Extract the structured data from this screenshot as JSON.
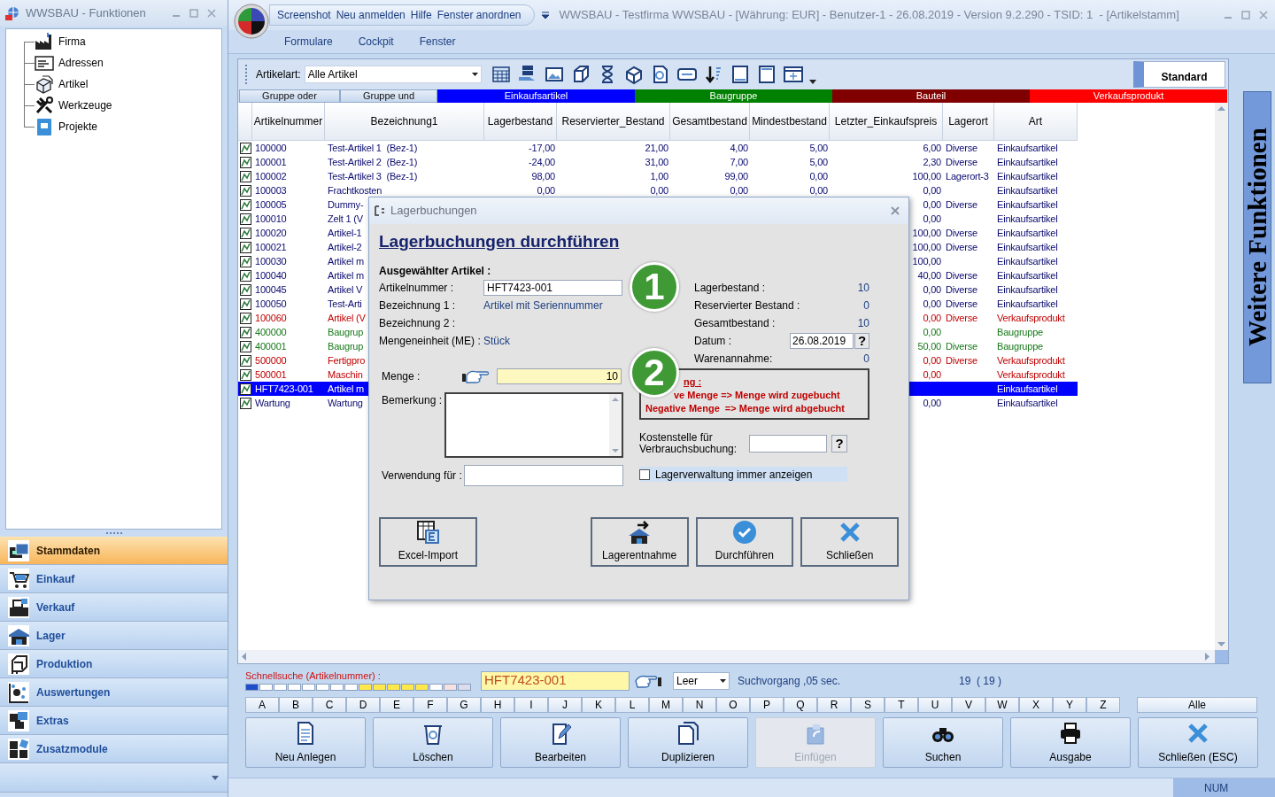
{
  "left_window": {
    "title": "WWSBAU - Funktionen",
    "tree": [
      {
        "label": "Firma"
      },
      {
        "label": "Adressen"
      },
      {
        "label": "Artikel"
      },
      {
        "label": "Werkzeuge"
      },
      {
        "label": "Projekte"
      }
    ],
    "nav": [
      {
        "label": "Stammdaten",
        "selected": true
      },
      {
        "label": "Einkauf",
        "selected": false
      },
      {
        "label": "Verkauf",
        "selected": false
      },
      {
        "label": "Lager",
        "selected": false
      },
      {
        "label": "Produktion",
        "selected": false
      },
      {
        "label": "Auswertungen",
        "selected": false
      },
      {
        "label": "Extras",
        "selected": false
      },
      {
        "label": "Zusatzmodule",
        "selected": false
      }
    ]
  },
  "main_window": {
    "quick_access": [
      "Screenshot",
      "Neu anmelden",
      "Hilfe",
      "Fenster anordnen"
    ],
    "title": "WWSBAU - Testfirma WWSBAU - [Währung: EUR] - Benutzer-1 - 26.08.2019 - Version 9.2.290 - TSID: 1  - [Artikelstamm]",
    "ribbon_tabs": [
      "Formulare",
      "Cockpit",
      "Fenster"
    ]
  },
  "toolbar": {
    "artikelart_label": "Artikelart:",
    "artikelart_value": "Alle Artikel",
    "standard_button": "Standard"
  },
  "legend": [
    {
      "label": "Gruppe oder",
      "kind": "button"
    },
    {
      "label": "Gruppe und",
      "kind": "button"
    },
    {
      "label": "Einkaufsartikel",
      "kind": "swatch",
      "color": "#0000ff"
    },
    {
      "label": "Baugruppe",
      "kind": "swatch",
      "color": "#008000"
    },
    {
      "label": "Bauteil",
      "kind": "swatch",
      "color": "#800000"
    },
    {
      "label": "Verkaufsprodukt",
      "kind": "swatch",
      "color": "#ff0000"
    }
  ],
  "table": {
    "columns": [
      "Artikelnummer",
      "Bezeichnung1",
      "Lagerbestand",
      "Reservierter_Bestand",
      "Gesamtbestand",
      "Mindestbestand",
      "Letzter_Einkaufspreis",
      "Lagerort",
      "Art"
    ],
    "rows": [
      {
        "kind": "einkauf",
        "selected": false,
        "nr": "100000",
        "bez": "Test-Artikel 1  (Bez-1)",
        "lager": "-17,00",
        "reserv": "21,00",
        "gesamt": "4,00",
        "mindest": "5,00",
        "preis": "6,00",
        "ort": "Diverse",
        "art": "Einkaufsartikel"
      },
      {
        "kind": "einkauf",
        "selected": false,
        "nr": "100001",
        "bez": "Test-Artikel 2  (Bez-1)",
        "lager": "-24,00",
        "reserv": "31,00",
        "gesamt": "7,00",
        "mindest": "5,00",
        "preis": "2,30",
        "ort": "Diverse",
        "art": "Einkaufsartikel"
      },
      {
        "kind": "einkauf",
        "selected": false,
        "nr": "100002",
        "bez": "Test-Artikel 3  (Bez-1)",
        "lager": "98,00",
        "reserv": "1,00",
        "gesamt": "99,00",
        "mindest": "0,00",
        "preis": "100,00",
        "ort": "Lagerort-3",
        "art": "Einkaufsartikel"
      },
      {
        "kind": "einkauf",
        "selected": false,
        "nr": "100003",
        "bez": "Frachtkosten",
        "lager": "0,00",
        "reserv": "0,00",
        "gesamt": "0,00",
        "mindest": "0,00",
        "preis": "0,00",
        "art": "Einkaufsartikel"
      },
      {
        "kind": "einkauf",
        "selected": false,
        "nr": "100005",
        "bez": "Dummy-",
        "preis": "0,00",
        "ort": "Diverse",
        "art": "Einkaufsartikel"
      },
      {
        "kind": "einkauf",
        "selected": false,
        "nr": "100010",
        "bez": "Zelt 1 (V",
        "preis": "0,00",
        "art": "Einkaufsartikel"
      },
      {
        "kind": "einkauf",
        "selected": false,
        "nr": "100020",
        "bez": "Artikel-1",
        "preis": "100,00",
        "ort": "Diverse",
        "art": "Einkaufsartikel"
      },
      {
        "kind": "einkauf",
        "selected": false,
        "nr": "100021",
        "bez": "Artikel-2",
        "preis": "100,00",
        "ort": "Diverse",
        "art": "Einkaufsartikel"
      },
      {
        "kind": "einkauf",
        "selected": false,
        "nr": "100030",
        "bez": "Artikel m",
        "preis": "100,00",
        "art": "Einkaufsartikel"
      },
      {
        "kind": "einkauf",
        "selected": false,
        "nr": "100040",
        "bez": "Artikel m",
        "preis": "40,00",
        "ort": "Diverse",
        "art": "Einkaufsartikel"
      },
      {
        "kind": "einkauf",
        "selected": false,
        "nr": "100045",
        "bez": "Artikel V",
        "preis": "0,00",
        "ort": "Diverse",
        "art": "Einkaufsartikel"
      },
      {
        "kind": "einkauf",
        "selected": false,
        "nr": "100050",
        "bez": "Test-Arti",
        "preis": "0,00",
        "ort": "Diverse",
        "art": "Einkaufsartikel"
      },
      {
        "kind": "verkauf",
        "selected": false,
        "nr": "100060",
        "bez": "Artikel (V",
        "preis": "0,00",
        "ort": "Diverse",
        "art": "Verkaufsprodukt"
      },
      {
        "kind": "baugruppe",
        "selected": false,
        "nr": "400000",
        "bez": "Baugrup",
        "preis": "0,00",
        "art": "Baugruppe"
      },
      {
        "kind": "baugruppe",
        "selected": false,
        "nr": "400001",
        "bez": "Baugrup",
        "preis": "50,00",
        "ort": "Diverse",
        "art": "Baugruppe"
      },
      {
        "kind": "verkauf",
        "selected": false,
        "nr": "500000",
        "bez": "Fertigpro",
        "preis": "0,00",
        "ort": "Diverse",
        "art": "Verkaufsprodukt"
      },
      {
        "kind": "verkauf",
        "selected": false,
        "nr": "500001",
        "bez": "Maschin",
        "preis": "0,00",
        "art": "Verkaufsprodukt"
      },
      {
        "kind": "einkauf",
        "selected": true,
        "nr": "HFT7423-001",
        "bez": "Artikel m",
        "art": "Einkaufsartikel"
      },
      {
        "kind": "einkauf",
        "selected": false,
        "nr": "Wartung",
        "bez": "Wartung",
        "preis": "0,00",
        "art": "Einkaufsartikel"
      }
    ]
  },
  "side_panel": {
    "label": "Weitere Funktionen"
  },
  "dialog": {
    "title": "Lagerbuchungen",
    "heading": "Lagerbuchungen durchführen",
    "section": "Ausgewählter Artikel :",
    "left_fields": [
      {
        "label": "Artikelnummer :",
        "value": "HFT7423-001",
        "kind": "input"
      },
      {
        "label": "Bezeichnung 1 :",
        "value": "Artikel mit Seriennummer",
        "kind": "text"
      },
      {
        "label": "Bezeichnung 2 :",
        "kind": "text"
      },
      {
        "label": "Mengeneinheit (ME) :",
        "value": "Stück",
        "kind": "text"
      }
    ],
    "right_fields": [
      {
        "label": "Lagerbestand :",
        "value": "10",
        "kind": "text"
      },
      {
        "label": "Reservierter Bestand :",
        "value": "0",
        "kind": "text"
      },
      {
        "label": "Gesamtbestand :",
        "value": "10",
        "kind": "text"
      },
      {
        "label": "Datum :",
        "value": "26.08.2019",
        "kind": "date",
        "help": "?"
      },
      {
        "label": "Warenannahme:",
        "value": "0",
        "kind": "text"
      }
    ],
    "menge": {
      "label": "Menge :",
      "value": "10"
    },
    "bemerkung": {
      "label": "Bemerkung :"
    },
    "verwendung": {
      "label": "Verwendung für :"
    },
    "hint": [
      "ng :",
      "ve Menge => Menge wird zugebucht",
      "Negative Menge  => Menge wird abgebucht"
    ],
    "kostenstelle": {
      "label": "Kostenstelle für Verbrauchsbuchung:",
      "help": "?"
    },
    "always_show": {
      "label": "Lagerverwaltung immer anzeigen",
      "checked": false
    },
    "buttons": [
      {
        "label": "Excel-Import"
      },
      {
        "label": "Lagerentnahme"
      },
      {
        "label": "Durchführen"
      },
      {
        "label": "Schließen"
      }
    ],
    "annotations": [
      "1",
      "2"
    ]
  },
  "search": {
    "label": "Schnellsuche (Artikelnummer) :",
    "value": "HFT7423-001",
    "mode": "Leer",
    "timing": "Suchvorgang ,05 sec.",
    "count": "19  ( 19 )"
  },
  "alphabet": [
    "A",
    "B",
    "C",
    "D",
    "E",
    "F",
    "G",
    "H",
    "I",
    "J",
    "K",
    "L",
    "M",
    "N",
    "O",
    "P",
    "Q",
    "R",
    "S",
    "T",
    "U",
    "V",
    "W",
    "X",
    "Y",
    "Z"
  ],
  "alphabet_all": "Alle",
  "actions": [
    {
      "label": "Neu Anlegen",
      "disabled": false
    },
    {
      "label": "Löschen",
      "disabled": false
    },
    {
      "label": "Bearbeiten",
      "disabled": false
    },
    {
      "label": "Duplizieren",
      "disabled": false
    },
    {
      "label": "Einfügen",
      "disabled": true
    },
    {
      "label": "Suchen",
      "disabled": false
    },
    {
      "label": "Ausgabe",
      "disabled": false
    },
    {
      "label": "Schließen (ESC)",
      "disabled": false
    }
  ],
  "status_bar": {
    "num": "NUM"
  }
}
